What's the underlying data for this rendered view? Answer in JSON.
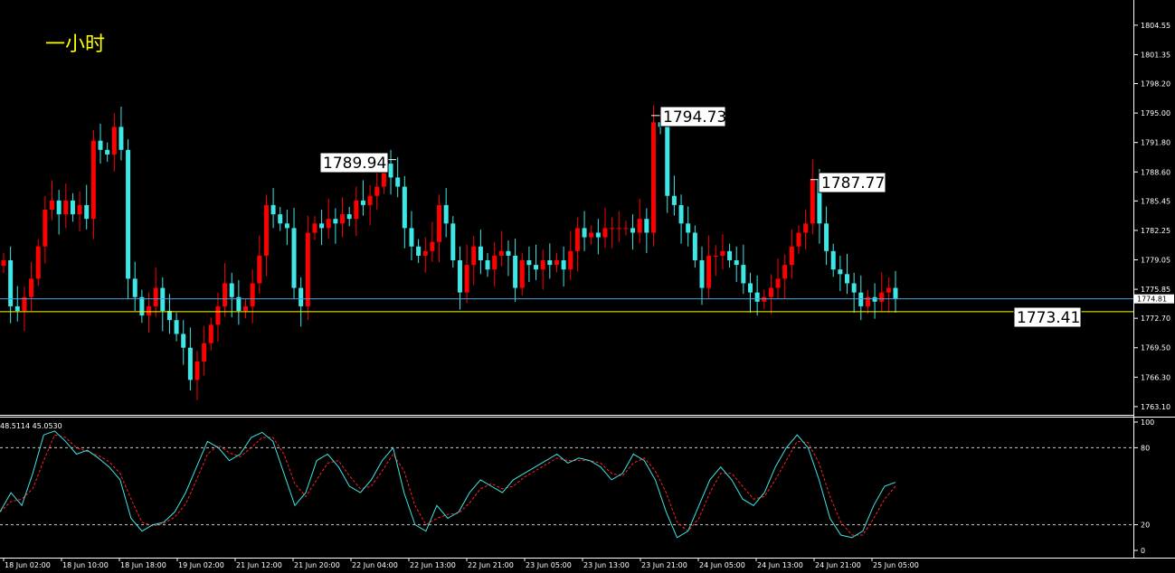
{
  "timeframe_label": "一小时",
  "colors": {
    "up": "#ff0000",
    "down": "#3ee6e6",
    "current": "#4aa3df",
    "support": "#ffff00",
    "k_line": "#3ee6e6",
    "d_line": "#ff2020"
  },
  "chart_data": [
    {
      "type": "candlestick",
      "title": "",
      "y_range": [
        1762.6,
        1806.5
      ],
      "y_ticks": [
        1763.1,
        1766.3,
        1769.5,
        1772.7,
        1775.85,
        1779.05,
        1782.25,
        1785.45,
        1788.6,
        1791.8,
        1795.0,
        1798.2,
        1801.35,
        1804.55
      ],
      "x_labels": [
        "18 Jun 02:00",
        "18 Jun 10:00",
        "18 Jun 18:00",
        "19 Jun 02:00",
        "21 Jun 12:00",
        "21 Jun 20:00",
        "22 Jun 04:00",
        "22 Jun 13:00",
        "22 Jun 21:00",
        "23 Jun 05:00",
        "23 Jun 13:00",
        "23 Jun 21:00",
        "24 Jun 05:00",
        "24 Jun 13:00",
        "24 Jun 21:00",
        "25 Jun 05:00"
      ],
      "current_price": "1774.81",
      "current_price_value": 1774.81,
      "support_level": 1773.41,
      "annotations": [
        {
          "text": "1789.94",
          "value": 1789.94
        },
        {
          "text": "1794.73",
          "value": 1794.73
        },
        {
          "text": "1787.77",
          "value": 1787.77
        },
        {
          "text": "1773.41",
          "value": 1773.41
        }
      ],
      "close_series": [
        1779,
        1774,
        1773.5,
        1775,
        1777,
        1780.5,
        1784.5,
        1785.5,
        1784,
        1785.5,
        1784,
        1785,
        1783.5,
        1792,
        1791,
        1790.5,
        1793.5,
        1791,
        1777,
        1775,
        1773,
        1774,
        1776,
        1773.5,
        1772.5,
        1771,
        1769.5,
        1766,
        1768,
        1770,
        1772,
        1774,
        1776.5,
        1775,
        1773.5,
        1774,
        1776.5,
        1779.5,
        1785,
        1784,
        1783,
        1782.5,
        1776,
        1774,
        1782,
        1783,
        1782.5,
        1783.5,
        1783,
        1784,
        1783.5,
        1785.5,
        1785,
        1786,
        1787,
        1789.5,
        1788,
        1787,
        1782.5,
        1780.5,
        1779.5,
        1780,
        1781,
        1785,
        1783,
        1779,
        1775.5,
        1778.5,
        1780.5,
        1779,
        1778,
        1779.5,
        1780,
        1779.5,
        1776,
        1779,
        1778.5,
        1778,
        1779,
        1778.5,
        1779,
        1778,
        1780,
        1782.5,
        1781.5,
        1782,
        1781.5,
        1782.5,
        1782.5,
        1782.5,
        1782.5,
        1782,
        1783.5,
        1782,
        1794,
        1793.5,
        1786,
        1785,
        1783,
        1782,
        1779,
        1776,
        1779.5,
        1779.5,
        1780,
        1779,
        1778.5,
        1776.5,
        1775.5,
        1774.5,
        1775,
        1776,
        1777,
        1778.5,
        1780.5,
        1782,
        1783,
        1787.77,
        1783,
        1780,
        1778,
        1777.5,
        1776.5,
        1775.5,
        1774,
        1775,
        1774.5,
        1775.5,
        1776,
        1774.81
      ]
    },
    {
      "type": "line",
      "title": "",
      "label": "48.5114 45.0530",
      "y_range": [
        0,
        100
      ],
      "y_ticks": [
        100,
        80,
        20,
        0
      ],
      "levels": [
        80,
        20
      ],
      "k_values": [
        30,
        45,
        35,
        60,
        90,
        93,
        85,
        75,
        78,
        72,
        65,
        55,
        25,
        15,
        20,
        22,
        30,
        45,
        65,
        85,
        80,
        70,
        75,
        88,
        92,
        85,
        60,
        35,
        45,
        70,
        75,
        65,
        50,
        45,
        55,
        70,
        80,
        45,
        20,
        15,
        35,
        25,
        30,
        45,
        55,
        50,
        45,
        55,
        60,
        65,
        70,
        75,
        68,
        72,
        70,
        65,
        55,
        60,
        75,
        70,
        55,
        30,
        10,
        15,
        35,
        55,
        65,
        55,
        40,
        35,
        45,
        65,
        80,
        90,
        80,
        55,
        25,
        12,
        10,
        15,
        35,
        50,
        53
      ],
      "d_values": [
        30,
        38,
        40,
        48,
        70,
        90,
        88,
        80,
        77,
        74,
        69,
        60,
        40,
        22,
        19,
        21,
        26,
        36,
        55,
        75,
        82,
        76,
        73,
        80,
        88,
        88,
        75,
        52,
        42,
        55,
        68,
        70,
        58,
        48,
        50,
        62,
        75,
        62,
        35,
        20,
        25,
        28,
        29,
        37,
        48,
        52,
        48,
        50,
        57,
        62,
        67,
        72,
        70,
        70,
        70,
        68,
        60,
        58,
        68,
        72,
        62,
        45,
        22,
        15,
        25,
        45,
        60,
        60,
        50,
        40,
        42,
        55,
        70,
        85,
        84,
        68,
        42,
        22,
        12,
        12,
        25,
        40,
        50
      ]
    }
  ]
}
